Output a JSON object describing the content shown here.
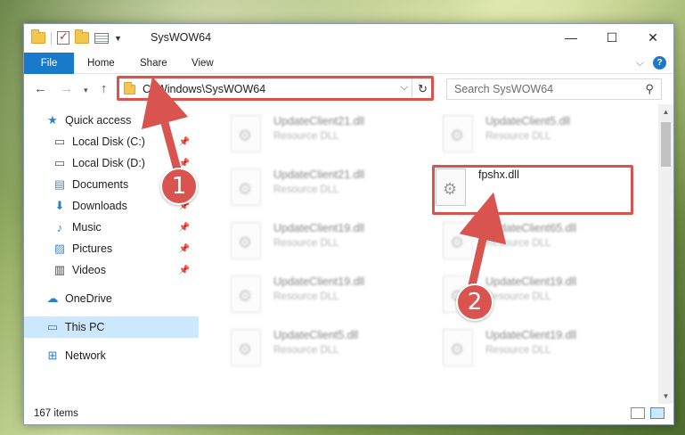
{
  "window": {
    "title": "SysWOW64",
    "caption_minimize": "—",
    "caption_maximize": "☐",
    "caption_close": "✕"
  },
  "ribbon": {
    "tabs": [
      "File",
      "Home",
      "Share",
      "View"
    ]
  },
  "navigation": {
    "address": "C:\\Windows\\SysWOW64",
    "search_placeholder": "Search SysWOW64"
  },
  "sidebar": {
    "items": [
      {
        "label": "Quick access",
        "icon": "star-icon"
      },
      {
        "label": "Local Disk (C:)",
        "icon": "drive-icon",
        "pinned": true
      },
      {
        "label": "Local Disk (D:)",
        "icon": "drive-icon",
        "pinned": true
      },
      {
        "label": "Documents",
        "icon": "documents-icon",
        "pinned": true
      },
      {
        "label": "Downloads",
        "icon": "downloads-icon",
        "pinned": true
      },
      {
        "label": "Music",
        "icon": "music-icon",
        "pinned": true
      },
      {
        "label": "Pictures",
        "icon": "pictures-icon",
        "pinned": true
      },
      {
        "label": "Videos",
        "icon": "videos-icon",
        "pinned": true
      },
      {
        "label": "OneDrive",
        "icon": "cloud-icon"
      },
      {
        "label": "This PC",
        "icon": "computer-icon",
        "selected": true
      },
      {
        "label": "Network",
        "icon": "network-icon"
      }
    ]
  },
  "files": [
    {
      "name": "UpdateClient21.dll",
      "type": "Resource DLL"
    },
    {
      "name": "UpdateClient5.dll",
      "type": "Resource DLL"
    },
    {
      "name": "UpdateClient21.dll",
      "type": "Resource DLL"
    },
    {
      "name": "fpshx.dll",
      "type": ""
    },
    {
      "name": "UpdateClient19.dll",
      "type": "Resource DLL"
    },
    {
      "name": "UpdateClient65.dll",
      "type": "Resource DLL"
    },
    {
      "name": "UpdateClient19.dll",
      "type": "Resource DLL"
    },
    {
      "name": "UpdateClient19.dll",
      "type": "Resource DLL"
    },
    {
      "name": "UpdateClient5.dll",
      "type": "Resource DLL"
    },
    {
      "name": "UpdateClient19.dll",
      "type": "Resource DLL"
    }
  ],
  "status": {
    "item_count": "167 items"
  },
  "callouts": {
    "step1": "1",
    "step2": "2"
  },
  "colors": {
    "accent": "#1979ca",
    "highlight": "#d9534f",
    "selection": "#cce8ff"
  }
}
